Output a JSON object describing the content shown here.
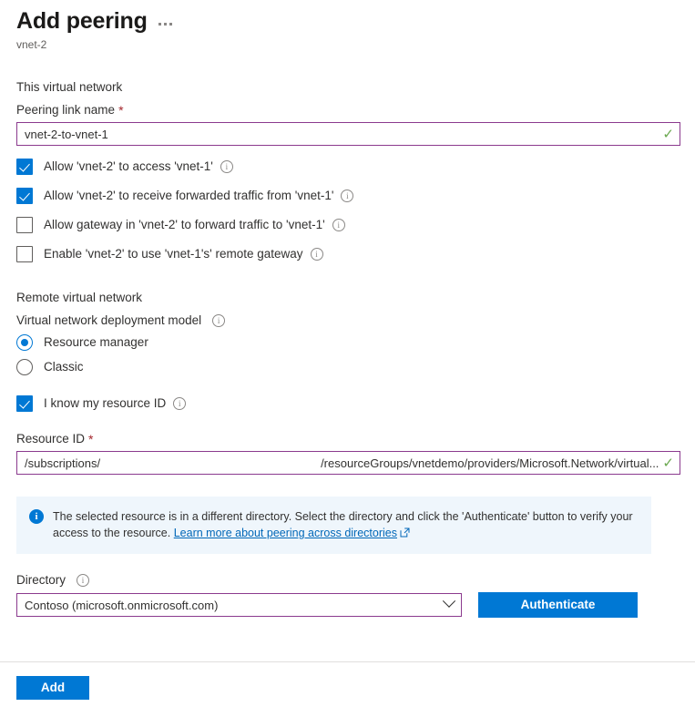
{
  "header": {
    "title": "Add peering",
    "subtitle": "vnet-2",
    "more_label": "More options"
  },
  "this_vnet": {
    "section_label": "This virtual network",
    "peering_link_name_label": "Peering link name",
    "required_mark": "*",
    "peering_link_name_value": "vnet-2-to-vnet-1",
    "valid_mark": "✓",
    "checkboxes": [
      {
        "label": "Allow 'vnet-2' to access 'vnet-1'",
        "checked": true,
        "info": "i"
      },
      {
        "label": "Allow 'vnet-2' to receive forwarded traffic from 'vnet-1'",
        "checked": true,
        "info": "i"
      },
      {
        "label": "Allow gateway in 'vnet-2' to forward traffic to 'vnet-1'",
        "checked": false,
        "info": "i"
      },
      {
        "label": "Enable 'vnet-2' to use 'vnet-1's' remote gateway",
        "checked": false,
        "info": "i"
      }
    ]
  },
  "remote_vnet": {
    "section_label": "Remote virtual network",
    "deployment_model_label": "Virtual network deployment model",
    "deployment_model_info": "i",
    "options": [
      {
        "label": "Resource manager",
        "selected": true
      },
      {
        "label": "Classic",
        "selected": false
      }
    ],
    "know_resource_id_label": "I know my resource ID",
    "know_resource_id_checked": true,
    "know_resource_id_info": "i",
    "resource_id_label": "Resource ID",
    "resource_id_required": "*",
    "resource_id_prefix": "/subscriptions/",
    "resource_id_suffix": "/resourceGroups/vnetdemo/providers/Microsoft.Network/virtual...",
    "resource_id_valid_mark": "✓"
  },
  "banner": {
    "icon": "info-icon",
    "text": "The selected resource is in a different directory. Select the directory and click the 'Authenticate' button to verify your access to the resource.",
    "link_text": "Learn more about peering across directories"
  },
  "directory": {
    "label": "Directory",
    "info": "i",
    "selected": "Contoso (microsoft.onmicrosoft.com)",
    "authenticate_label": "Authenticate"
  },
  "footer": {
    "add_label": "Add"
  },
  "colors": {
    "accent": "#0078d4",
    "input_border": "#8b3a8e",
    "banner_bg": "#eff6fc",
    "required": "#a4262c",
    "valid_green": "#6aa84f",
    "link": "#0067b8"
  }
}
